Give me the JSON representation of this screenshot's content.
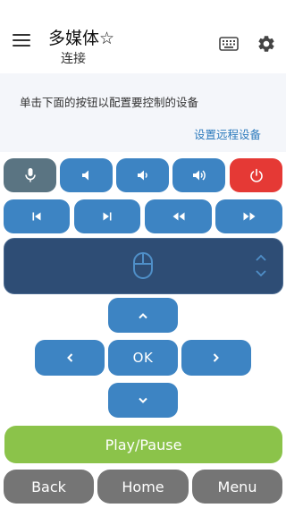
{
  "header": {
    "title": "多媒体☆",
    "subtitle": "连接"
  },
  "info": {
    "instruction": "单击下面的按钮以配置要控制的设备",
    "setup_link": "设置远程设备"
  },
  "keypad": {
    "ok_label": "OK"
  },
  "controls": {
    "play_pause": "Play/Pause",
    "back": "Back",
    "home": "Home",
    "menu": "Menu"
  },
  "colors": {
    "button": "#3d84c3",
    "mic_button": "#5a7482",
    "power_button": "#e53935",
    "touchpad": "#2e4d75",
    "play_button": "#8bc34a",
    "nav_button": "#757575",
    "link": "#2d7bbd"
  },
  "icons": [
    "menu-icon",
    "keyboard-icon",
    "gear-icon",
    "microphone-icon",
    "volume-mute-icon",
    "volume-down-icon",
    "volume-up-icon",
    "power-icon",
    "skip-previous-icon",
    "skip-next-icon",
    "rewind-icon",
    "fast-forward-icon",
    "mouse-icon",
    "scroll-arrows-icon",
    "chevron-up-icon",
    "chevron-left-icon",
    "chevron-right-icon",
    "chevron-down-icon"
  ]
}
